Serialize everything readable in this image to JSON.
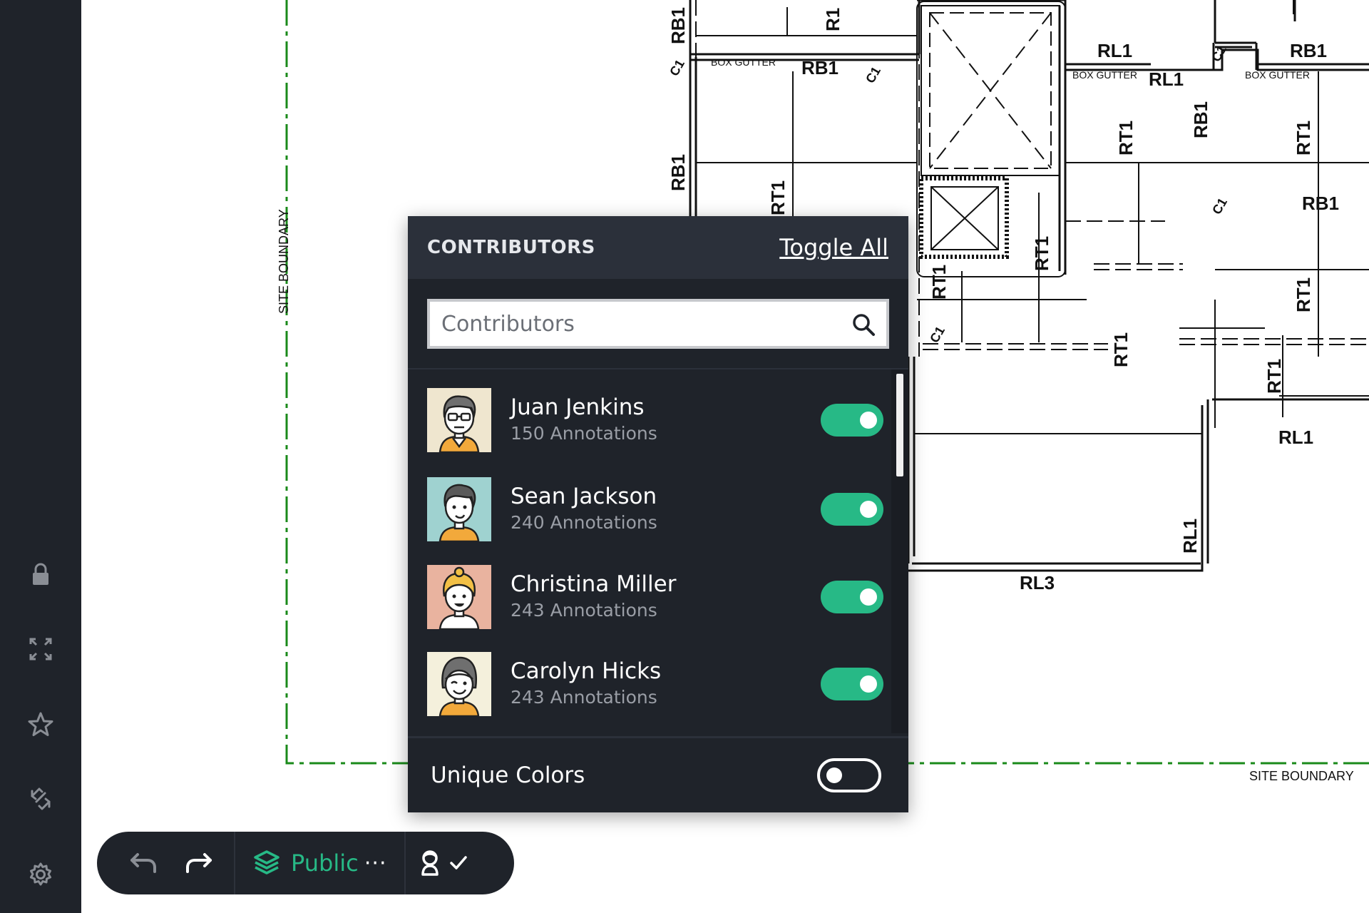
{
  "sidebar": {
    "items": [
      {
        "icon": "lock-icon"
      },
      {
        "icon": "fullscreen-icon"
      },
      {
        "icon": "star-icon"
      },
      {
        "icon": "sync-icon"
      },
      {
        "icon": "gear-icon"
      }
    ]
  },
  "drawing": {
    "labels": {
      "site_boundary": "SITE BOUNDARY",
      "box_gutter": "BOX GUTTER",
      "rb1": "RB1",
      "rl1": "RL1",
      "rl3": "RL3",
      "rt1": "RT1",
      "r1": "R1",
      "c1": "C1"
    }
  },
  "contributors_panel": {
    "title": "CONTRIBUTORS",
    "toggle_all": "Toggle All",
    "search_placeholder": "Contributors",
    "people": [
      {
        "name": "Juan Jenkins",
        "count": "150 Annotations",
        "enabled": true
      },
      {
        "name": "Sean Jackson",
        "count": "240 Annotations",
        "enabled": true
      },
      {
        "name": "Christina Miller",
        "count": "243 Annotations",
        "enabled": true
      },
      {
        "name": "Carolyn Hicks",
        "count": "243 Annotations",
        "enabled": true
      }
    ],
    "unique_colors_label": "Unique Colors",
    "unique_colors_enabled": false
  },
  "toolbar": {
    "visibility_label": "Public",
    "more_label": "···"
  },
  "colors": {
    "accent": "#27b986",
    "panel_bg": "#1f232a",
    "site_boundary": "#1a8a1a"
  }
}
